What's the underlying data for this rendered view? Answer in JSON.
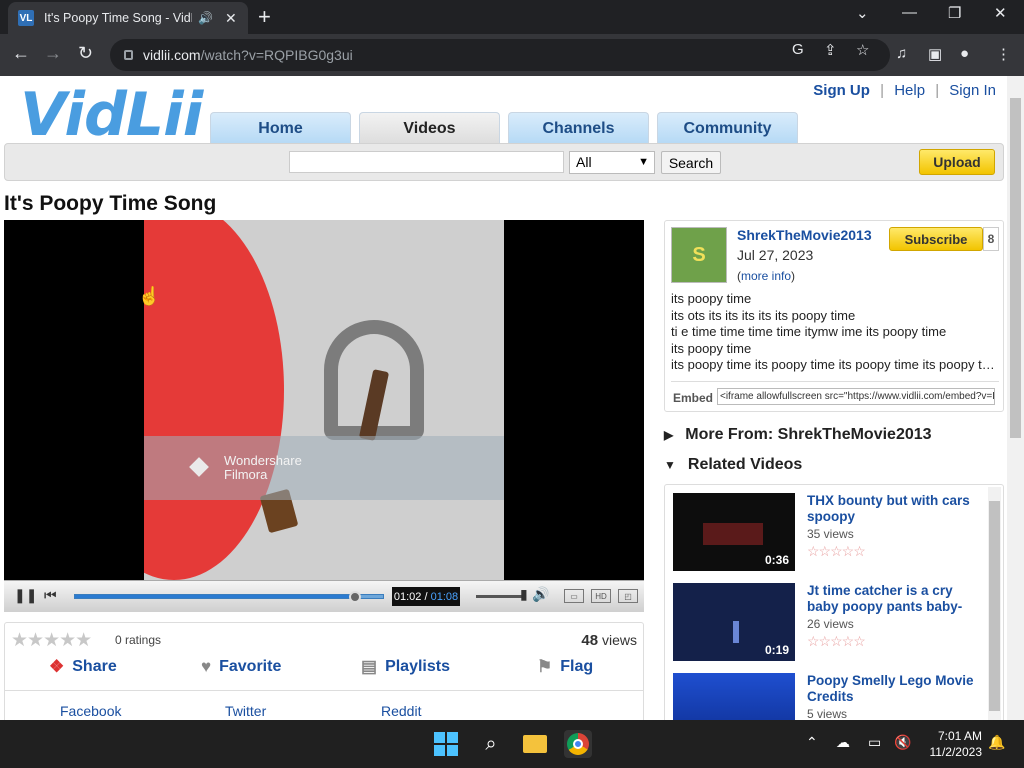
{
  "browser": {
    "tab_title": "It's Poopy Time Song - VidLii",
    "favicon_text": "VL",
    "url_host": "vidlii.com",
    "url_path": "/watch?v=RQPIBG0g3ui"
  },
  "site": {
    "logo": "VidLii",
    "top_links": {
      "sign_up": "Sign Up",
      "help": "Help",
      "sign_in": "Sign In",
      "separator": "|"
    },
    "nav_tabs": [
      "Home",
      "Videos",
      "Channels",
      "Community"
    ],
    "search": {
      "value": "",
      "category": "All",
      "button": "Search"
    },
    "upload_label": "Upload"
  },
  "video": {
    "title": "It's Poopy Time Song",
    "overlay_text": "Wondershare Filmora",
    "time_current": "01:02",
    "time_separator": "/",
    "time_total": "01:08",
    "progress_fraction": 0.91,
    "hd_label": "HD"
  },
  "stats": {
    "stars": "★★★★★",
    "ratings": "0 ratings",
    "views_count": "48",
    "views_label": "views"
  },
  "actions": {
    "share": "Share",
    "favorite": "Favorite",
    "playlists": "Playlists",
    "flag": "Flag"
  },
  "share_links": [
    "Facebook",
    "Twitter",
    "Reddit"
  ],
  "uploader": {
    "name": "ShrekTheMovie2013",
    "date": "Jul 27, 2023",
    "more_open": "(",
    "more_info": "more info",
    "more_close": ")",
    "subscribe": "Subscribe",
    "subscriber_count": "8",
    "avatar_text": "S",
    "description": [
      "its poopy time",
      "its ots its its its its its poopy time",
      "ti e time time time time itymw ime its poopy time",
      "its poopy time",
      "its poopy time its poopy time its poopy time its poopy time"
    ],
    "embed_label": "Embed",
    "embed_code": "<iframe allowfullscreen src=\"https://www.vidlii.com/embed?v=RQPIBG0g3ui\""
  },
  "sections": {
    "more_from": "More From: ShrekTheMovie2013",
    "related": "Related Videos"
  },
  "related_videos": [
    {
      "title": "THX bounty but with cars spoopy",
      "views": "35 views",
      "duration": "0:36",
      "stars": "☆☆☆☆☆"
    },
    {
      "title": "Jt time catcher is a cry baby poopy pants baby-",
      "views": "26 views",
      "duration": "0:19",
      "stars": "☆☆☆☆☆"
    },
    {
      "title": "Poopy Smelly Lego Movie Credits",
      "views": "5 views",
      "duration": "",
      "stars": "☆☆☆☆☆"
    }
  ],
  "taskbar": {
    "time": "7:01 AM",
    "date": "11/2/2023"
  },
  "colors": {
    "link": "#1a4fa0",
    "accent_yellow": "#f2c400",
    "logo_blue": "#4a9de0"
  }
}
